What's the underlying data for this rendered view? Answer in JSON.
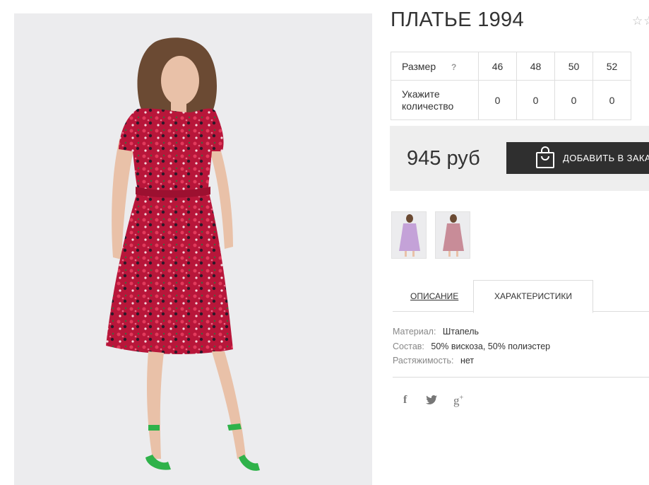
{
  "product": {
    "title": "ПЛАТЬЕ 1994",
    "rating_stars": "☆☆"
  },
  "size_table": {
    "size_label": "Размер",
    "help_icon": "?",
    "sizes": [
      "46",
      "48",
      "50",
      "52"
    ],
    "quantity_label_line1": "Укажите",
    "quantity_label_line2": "количество",
    "quantities": [
      "0",
      "0",
      "0",
      "0"
    ]
  },
  "price": {
    "value": "945 руб",
    "add_button_label": "ДОБАВИТЬ В ЗАКАЗ"
  },
  "tabs": {
    "description": "ОПИСАНИЕ",
    "characteristics": "ХАРАКТЕРИСТИКИ",
    "active": "characteristics"
  },
  "specs": [
    {
      "key": "Материал:",
      "value": "Штапель"
    },
    {
      "key": "Состав:",
      "value": "50% вискоза, 50% полиэстер"
    },
    {
      "key": "Растяжимость:",
      "value": "нет"
    }
  ],
  "social": {
    "facebook_glyph": "f",
    "gplus_glyph": "g"
  },
  "colors": {
    "dress": "#b8163a",
    "button": "#2f2f2f",
    "price_bg": "#eeeeee",
    "shoes": "#2fb24a"
  }
}
